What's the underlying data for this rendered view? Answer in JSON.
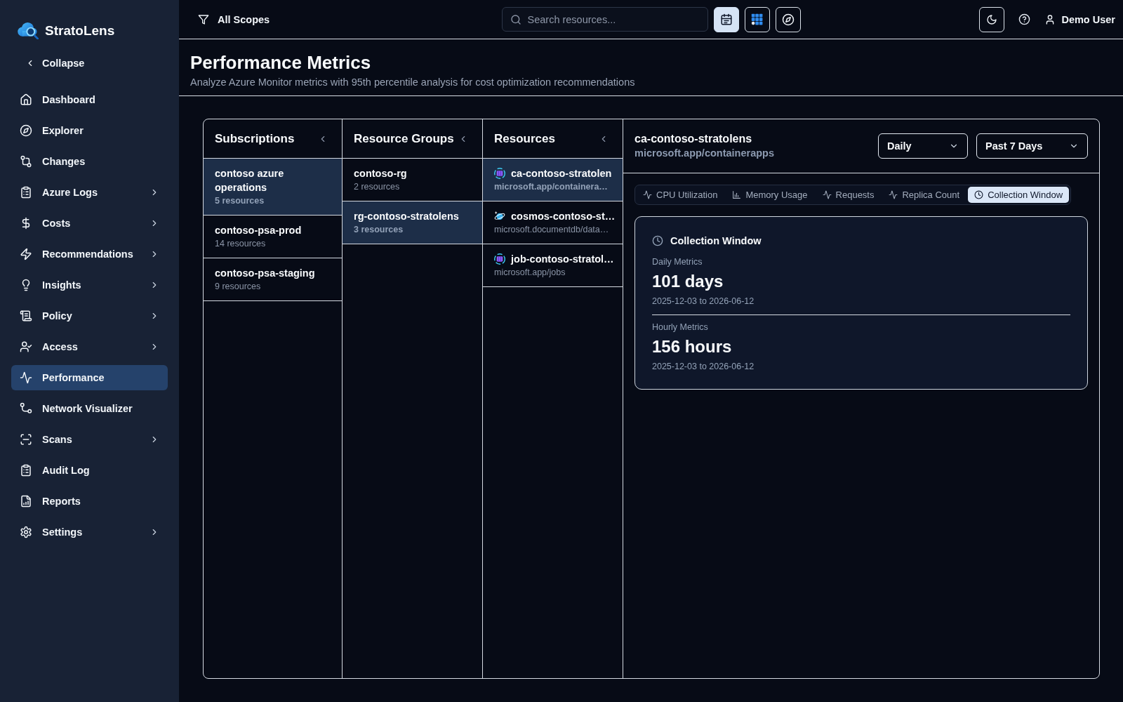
{
  "sidebar": {
    "brand": "StratoLens",
    "collapse": "Collapse",
    "items": [
      {
        "label": "Dashboard",
        "expandable": false,
        "selected": false
      },
      {
        "label": "Explorer",
        "expandable": false,
        "selected": false
      },
      {
        "label": "Changes",
        "expandable": false,
        "selected": false
      },
      {
        "label": "Azure Logs",
        "expandable": true,
        "selected": false
      },
      {
        "label": "Costs",
        "expandable": true,
        "selected": false
      },
      {
        "label": "Recommendations",
        "expandable": true,
        "selected": false
      },
      {
        "label": "Insights",
        "expandable": true,
        "selected": false
      },
      {
        "label": "Policy",
        "expandable": true,
        "selected": false
      },
      {
        "label": "Access",
        "expandable": true,
        "selected": false
      },
      {
        "label": "Performance",
        "expandable": false,
        "selected": true
      },
      {
        "label": "Network Visualizer",
        "expandable": false,
        "selected": false
      },
      {
        "label": "Scans",
        "expandable": true,
        "selected": false
      },
      {
        "label": "Audit Log",
        "expandable": false,
        "selected": false
      },
      {
        "label": "Reports",
        "expandable": false,
        "selected": false
      },
      {
        "label": "Settings",
        "expandable": true,
        "selected": false
      }
    ]
  },
  "topbar": {
    "scope": "All Scopes",
    "search": {
      "placeholder": "Search resources..."
    },
    "tools": [
      {
        "selected": true
      },
      {
        "selected": false
      },
      {
        "selected": false
      }
    ],
    "user": "Demo User"
  },
  "page": {
    "title": "Performance Metrics",
    "subtitle": "Analyze Azure Monitor metrics with 95th percentile analysis for cost optimization recommendations"
  },
  "columns": [
    {
      "title": "Subscriptions",
      "items": [
        {
          "name": "contoso azure operations",
          "meta": "5 resources",
          "selected": true
        },
        {
          "name": "contoso-psa-prod",
          "meta": "14 resources",
          "selected": false
        },
        {
          "name": "contoso-psa-staging",
          "meta": "9 resources",
          "selected": false
        }
      ]
    },
    {
      "title": "Resource Groups",
      "items": [
        {
          "name": "contoso-rg",
          "meta": "2 resources",
          "selected": false
        },
        {
          "name": "rg-contoso-stratolens",
          "meta": "3 resources",
          "selected": true
        }
      ]
    },
    {
      "title": "Resources",
      "items": [
        {
          "name": "ca-contoso-stratolen",
          "meta": "microsoft.app/containera…",
          "selected": true
        },
        {
          "name": "cosmos-contoso-st…",
          "meta": "microsoft.documentdb/data…",
          "selected": false
        },
        {
          "name": "job-contoso-stratol…",
          "meta": "microsoft.app/jobs",
          "selected": false
        }
      ]
    }
  ],
  "detail": {
    "name": "ca-contoso-stratolens",
    "type": "microsoft.app/containerapps",
    "selects": [
      "Daily",
      "Past 7 Days"
    ],
    "tabs": [
      {
        "label": "CPU Utilization",
        "selected": false
      },
      {
        "label": "Memory Usage",
        "selected": false
      },
      {
        "label": "Requests",
        "selected": false
      },
      {
        "label": "Replica Count",
        "selected": false
      },
      {
        "label": "Collection Window",
        "selected": true
      }
    ],
    "card": {
      "title": "Collection Window",
      "metrics": [
        {
          "label": "Daily Metrics",
          "value": "101 days",
          "range": "2025-12-03 to 2026-06-12"
        },
        {
          "label": "Hourly Metrics",
          "value": "156 hours",
          "range": "2025-12-03 to 2026-06-12"
        }
      ]
    }
  }
}
